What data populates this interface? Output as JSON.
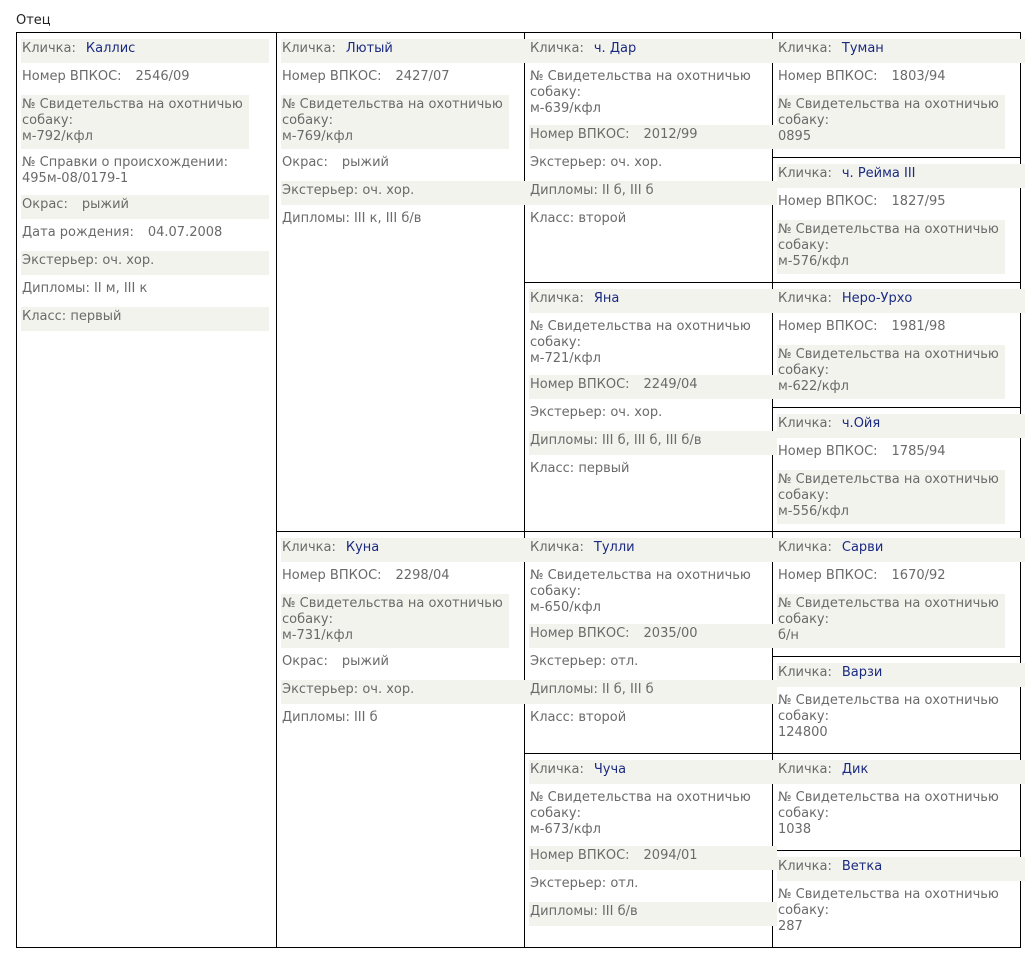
{
  "section_title": "Отец",
  "labels": {
    "name": "Кличка:",
    "vpkos": "Номер ВПКОС:",
    "cert": "№ Свидетельства на охотничью собаку:",
    "origin": "№ Справки о происхождении:",
    "color": "Окрас:",
    "birth": "Дата рождения:",
    "exterior": "Экстерьер:",
    "diplomas": "Дипломы:",
    "class": "Класс:"
  },
  "sire": {
    "name": "Каллис",
    "vpkos": "2546/09",
    "cert": "м-792/кфл",
    "origin": "495м-08/0179-1",
    "color": "рыжий",
    "birth": "04.07.2008",
    "exterior": "оч. хор.",
    "diplomas": "II м, III к",
    "class": "первый"
  },
  "gen2": {
    "father": {
      "name": "Лютый",
      "vpkos": "2427/07",
      "cert": "м-769/кфл",
      "color": "рыжий",
      "exterior": "оч. хор.",
      "diplomas": "III к, III б/в"
    },
    "mother": {
      "name": "Куна",
      "vpkos": "2298/04",
      "cert": "м-731/кфл",
      "color": "рыжий",
      "exterior": "оч. хор.",
      "diplomas": "III б"
    }
  },
  "gen3": {
    "ff": {
      "name": "ч. Дар",
      "cert": "м-639/кфл",
      "vpkos": "2012/99",
      "exterior": "оч. хор.",
      "diplomas": "II б, III б",
      "class": "второй"
    },
    "fm": {
      "name": "Яна",
      "cert": "м-721/кфл",
      "vpkos": "2249/04",
      "exterior": "оч. хор.",
      "diplomas": "III б, III б, III б/в",
      "class": "первый"
    },
    "mf": {
      "name": "Тулли",
      "cert": "м-650/кфл",
      "vpkos": "2035/00",
      "exterior": "отл.",
      "diplomas": "II б, III б",
      "class": "второй"
    },
    "mm": {
      "name": "Чуча",
      "cert": "м-673/кфл",
      "vpkos": "2094/01",
      "exterior": "отл.",
      "diplomas": "III б/в"
    }
  },
  "gen4": {
    "fff": {
      "name": "Туман",
      "vpkos": "1803/94",
      "cert": "0895"
    },
    "ffm": {
      "name": "ч. Рейма III",
      "vpkos": "1827/95",
      "cert": "м-576/кфл"
    },
    "fmf": {
      "name": "Неро-Урхо",
      "vpkos": "1981/98",
      "cert": "м-622/кфл"
    },
    "fmm": {
      "name": "ч.Ойя",
      "vpkos": "1785/94",
      "cert": "м-556/кфл"
    },
    "mff": {
      "name": "Сарви",
      "vpkos": "1670/92",
      "cert": "б/н"
    },
    "mfm": {
      "name": "Варзи",
      "cert": "124800"
    },
    "mmf": {
      "name": "Дик",
      "cert": "1038"
    },
    "mmm": {
      "name": "Ветка",
      "cert": "287"
    }
  }
}
